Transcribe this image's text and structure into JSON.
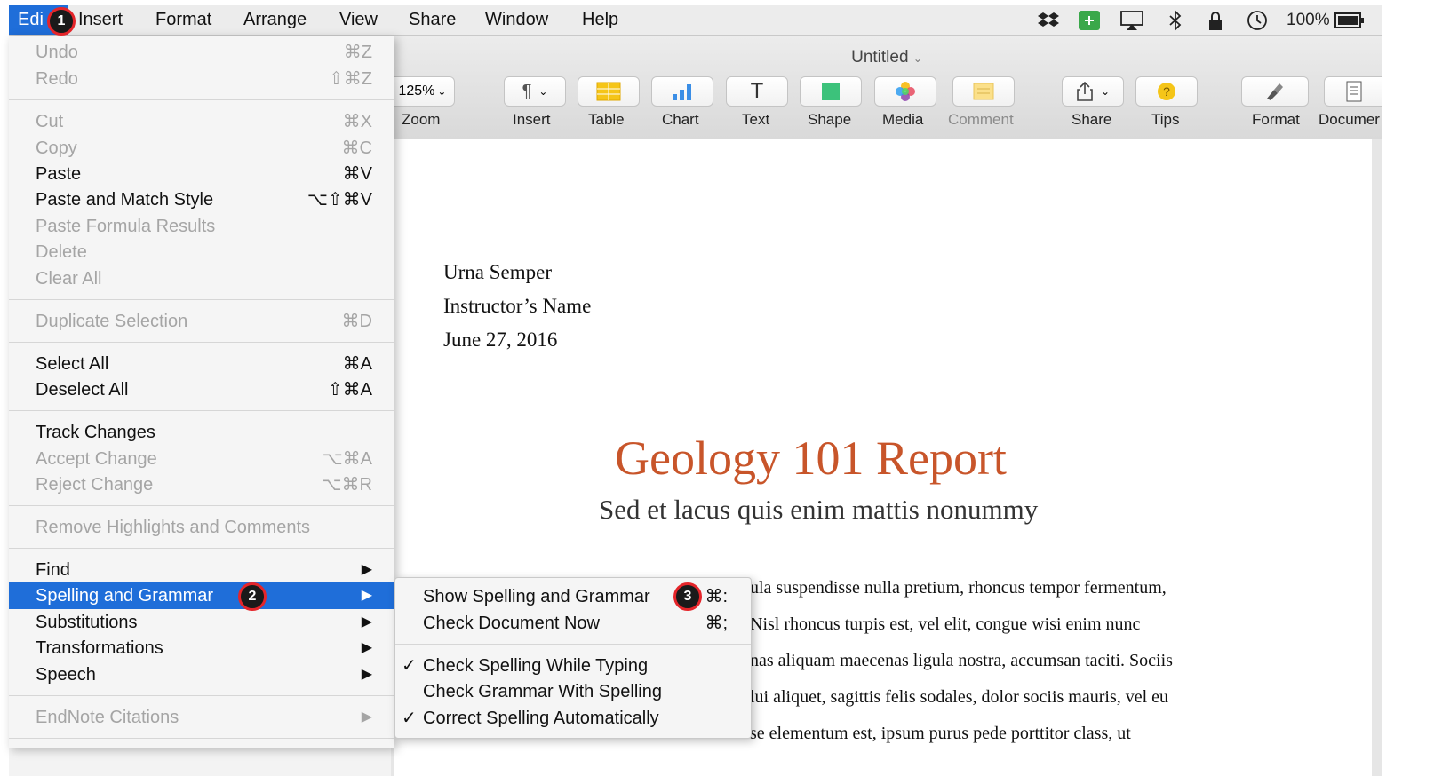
{
  "menubar": {
    "edit": "Edi",
    "items": [
      "Insert",
      "Format",
      "Arrange",
      "View",
      "Share",
      "Window",
      "Help"
    ],
    "battery": "100%"
  },
  "window": {
    "title": "Untitled",
    "zoom_value": "125%",
    "toolbar": {
      "zoom": "Zoom",
      "insert": "Insert",
      "table": "Table",
      "chart": "Chart",
      "text": "Text",
      "shape": "Shape",
      "media": "Media",
      "comment": "Comment",
      "share": "Share",
      "tips": "Tips",
      "format": "Format",
      "document": "Documer"
    }
  },
  "document": {
    "name": "Urna Semper",
    "instructor": "Instructor’s Name",
    "date": "June 27, 2016",
    "title": "Geology 101 Report",
    "subtitle": "Sed et lacus quis enim mattis nonummy",
    "lines": [
      "ula suspendisse nulla pretium, rhoncus tempor fermentum,",
      "Nisl rhoncus turpis est, vel elit, congue wisi enim nunc",
      "nas aliquam maecenas ligula nostra, accumsan taciti. Sociis",
      "lui aliquet, sagittis felis sodales, dolor sociis mauris, vel eu",
      "se elementum est, ipsum purus pede porttitor class, ut"
    ]
  },
  "edit_menu": {
    "undo": "Undo",
    "undo_sc": "⌘Z",
    "redo": "Redo",
    "redo_sc": "⇧⌘Z",
    "cut": "Cut",
    "cut_sc": "⌘X",
    "copy": "Copy",
    "copy_sc": "⌘C",
    "paste": "Paste",
    "paste_sc": "⌘V",
    "paste_match": "Paste and Match Style",
    "paste_match_sc": "⌥⇧⌘V",
    "paste_formula": "Paste Formula Results",
    "delete": "Delete",
    "clear_all": "Clear All",
    "duplicate": "Duplicate Selection",
    "duplicate_sc": "⌘D",
    "select_all": "Select All",
    "select_all_sc": "⌘A",
    "deselect_all": "Deselect All",
    "deselect_all_sc": "⇧⌘A",
    "track": "Track Changes",
    "accept": "Accept Change",
    "accept_sc": "⌥⌘A",
    "reject": "Reject Change",
    "reject_sc": "⌥⌘R",
    "remove_hl": "Remove Highlights and Comments",
    "find": "Find",
    "spelling": "Spelling and Grammar",
    "substitutions": "Substitutions",
    "transformations": "Transformations",
    "speech": "Speech",
    "endnote": "EndNote Citations"
  },
  "submenu": {
    "show": "Show Spelling and Grammar",
    "show_sc": "⌘:",
    "check_now": "Check Document Now",
    "check_now_sc": "⌘;",
    "while_typing": "Check Spelling While Typing",
    "grammar": "Check Grammar With Spelling",
    "auto": "Correct Spelling Automatically",
    "checkmark": "✓"
  },
  "badges": [
    "1",
    "2",
    "3"
  ],
  "colors": {
    "highlight": "#1f6ed9",
    "heading": "#c8552a",
    "badge_ring": "#e5252a"
  }
}
